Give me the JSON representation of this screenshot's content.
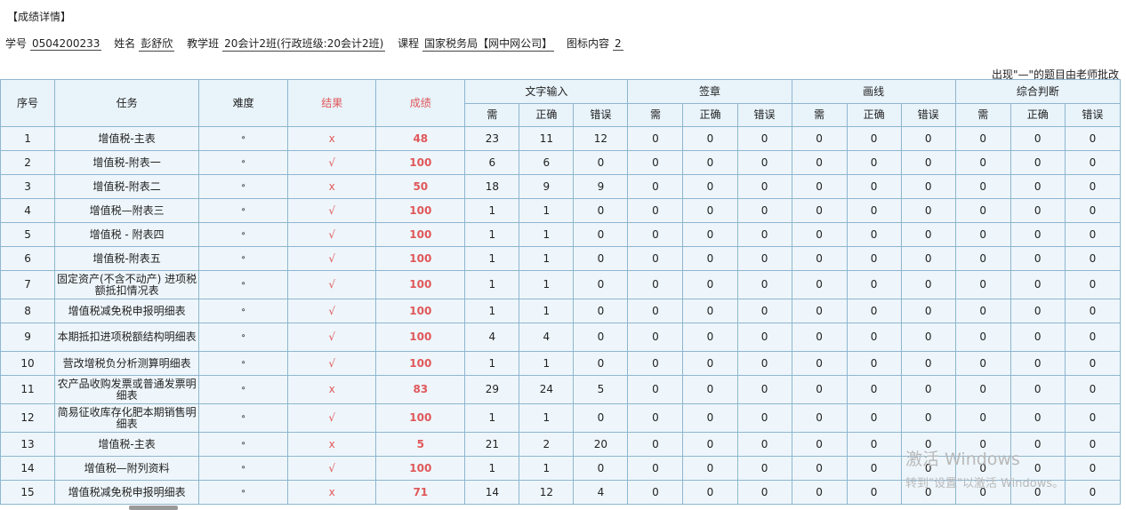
{
  "title": "【成绩详情】",
  "info": {
    "student_id_label": "学号",
    "student_id": "0504200233",
    "name_label": "姓名",
    "name": "彭舒欣",
    "class_label": "教学班",
    "class": "20会计2班(行政班级:20会计2班)",
    "course_label": "课程",
    "course": "国家税务局【网中网公司】",
    "chart_content_label": "图标内容",
    "chart_content": "2"
  },
  "note": "出现\"—\"的题目由老师批改",
  "table": {
    "headers": {
      "seq": "序号",
      "task": "任务",
      "difficulty": "难度",
      "result": "结果",
      "score": "成绩",
      "groups": [
        "文字输入",
        "签章",
        "画线",
        "综合判断"
      ],
      "sub": [
        "需",
        "正确",
        "错误"
      ]
    },
    "rows": [
      {
        "seq": "1",
        "task": "增值税-主表",
        "diff": "⚬",
        "result": "x",
        "score": "48",
        "v": [
          "23",
          "11",
          "12",
          "0",
          "0",
          "0",
          "0",
          "0",
          "0",
          "0",
          "0",
          "0"
        ]
      },
      {
        "seq": "2",
        "task": "增值税-附表一",
        "diff": "⚬",
        "result": "√",
        "score": "100",
        "v": [
          "6",
          "6",
          "0",
          "0",
          "0",
          "0",
          "0",
          "0",
          "0",
          "0",
          "0",
          "0"
        ]
      },
      {
        "seq": "3",
        "task": "增值税-附表二",
        "diff": "⚬",
        "result": "x",
        "score": "50",
        "v": [
          "18",
          "9",
          "9",
          "0",
          "0",
          "0",
          "0",
          "0",
          "0",
          "0",
          "0",
          "0"
        ]
      },
      {
        "seq": "4",
        "task": "增值税—附表三",
        "diff": "⚬",
        "result": "√",
        "score": "100",
        "v": [
          "1",
          "1",
          "0",
          "0",
          "0",
          "0",
          "0",
          "0",
          "0",
          "0",
          "0",
          "0"
        ]
      },
      {
        "seq": "5",
        "task": "增值税 - 附表四",
        "diff": "⚬",
        "result": "√",
        "score": "100",
        "v": [
          "1",
          "1",
          "0",
          "0",
          "0",
          "0",
          "0",
          "0",
          "0",
          "0",
          "0",
          "0"
        ]
      },
      {
        "seq": "6",
        "task": "增值税-附表五",
        "diff": "⚬",
        "result": "√",
        "score": "100",
        "v": [
          "1",
          "1",
          "0",
          "0",
          "0",
          "0",
          "0",
          "0",
          "0",
          "0",
          "0",
          "0"
        ]
      },
      {
        "seq": "7",
        "task": "固定资产(不含不动产) 进项税额抵扣情况表",
        "diff": "⚬",
        "result": "√",
        "score": "100",
        "v": [
          "1",
          "1",
          "0",
          "0",
          "0",
          "0",
          "0",
          "0",
          "0",
          "0",
          "0",
          "0"
        ]
      },
      {
        "seq": "8",
        "task": "增值税减免税申报明细表",
        "diff": "⚬",
        "result": "√",
        "score": "100",
        "v": [
          "1",
          "1",
          "0",
          "0",
          "0",
          "0",
          "0",
          "0",
          "0",
          "0",
          "0",
          "0"
        ]
      },
      {
        "seq": "9",
        "task": "本期抵扣进项税额结构明细表",
        "diff": "⚬",
        "result": "√",
        "score": "100",
        "v": [
          "4",
          "4",
          "0",
          "0",
          "0",
          "0",
          "0",
          "0",
          "0",
          "0",
          "0",
          "0"
        ]
      },
      {
        "seq": "10",
        "task": "营改增税负分析测算明细表",
        "diff": "⚬",
        "result": "√",
        "score": "100",
        "v": [
          "1",
          "1",
          "0",
          "0",
          "0",
          "0",
          "0",
          "0",
          "0",
          "0",
          "0",
          "0"
        ]
      },
      {
        "seq": "11",
        "task": "农产品收购发票或普通发票明细表",
        "diff": "⚬",
        "result": "x",
        "score": "83",
        "v": [
          "29",
          "24",
          "5",
          "0",
          "0",
          "0",
          "0",
          "0",
          "0",
          "0",
          "0",
          "0"
        ]
      },
      {
        "seq": "12",
        "task": "简易征收库存化肥本期销售明细表",
        "diff": "⚬",
        "result": "√",
        "score": "100",
        "v": [
          "1",
          "1",
          "0",
          "0",
          "0",
          "0",
          "0",
          "0",
          "0",
          "0",
          "0",
          "0"
        ]
      },
      {
        "seq": "13",
        "task": "增值税-主表",
        "diff": "⚬",
        "result": "x",
        "score": "5",
        "v": [
          "21",
          "2",
          "20",
          "0",
          "0",
          "0",
          "0",
          "0",
          "0",
          "0",
          "0",
          "0"
        ]
      },
      {
        "seq": "14",
        "task": "增值税—附列资料",
        "diff": "⚬",
        "result": "√",
        "score": "100",
        "v": [
          "1",
          "1",
          "0",
          "0",
          "0",
          "0",
          "0",
          "0",
          "0",
          "0",
          "0",
          "0"
        ]
      },
      {
        "seq": "15",
        "task": "增值税减免税申报明细表",
        "diff": "⚬",
        "result": "x",
        "score": "71",
        "v": [
          "14",
          "12",
          "4",
          "0",
          "0",
          "0",
          "0",
          "0",
          "0",
          "0",
          "0",
          "0"
        ]
      }
    ]
  },
  "watermark": {
    "line1": "激活 Windows",
    "line2": "转到\"设置\"以激活 Windows。"
  }
}
